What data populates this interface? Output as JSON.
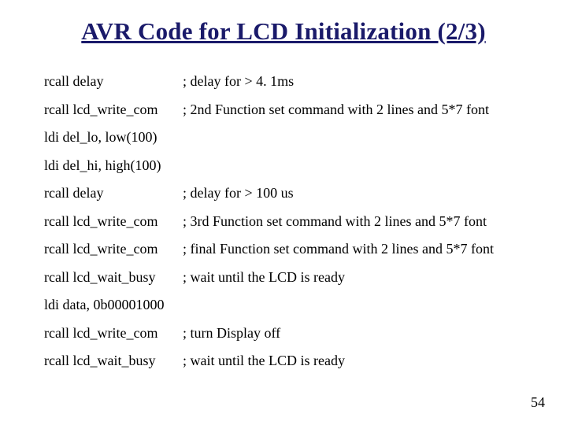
{
  "title": "AVR Code for LCD Initialization (2/3)",
  "lines": [
    {
      "code": "rcall delay",
      "comment": "; delay for > 4. 1ms"
    },
    {
      "code": "rcall lcd_write_com",
      "comment": " ; 2nd Function set command with 2 lines and 5*7 font"
    },
    {
      "code": "ldi del_lo, low(100)",
      "comment": ""
    },
    {
      "code": "ldi del_hi, high(100)",
      "comment": ""
    },
    {
      "code": "rcall delay",
      "comment": "; delay for > 100 us"
    },
    {
      "code": "rcall lcd_write_com",
      "comment": "; 3rd Function set command with 2 lines and 5*7 font"
    },
    {
      "code": "rcall lcd_write_com",
      "comment": "; final Function set command with 2 lines and 5*7 font"
    },
    {
      "code": "rcall lcd_wait_busy",
      "comment": "; wait until the LCD is ready"
    },
    {
      "code": "ldi data, 0b00001000",
      "comment": ""
    },
    {
      "code": "rcall lcd_write_com",
      "comment": "; turn Display off"
    },
    {
      "code": "rcall lcd_wait_busy",
      "comment": "; wait until the LCD is ready"
    }
  ],
  "page_number": "54"
}
